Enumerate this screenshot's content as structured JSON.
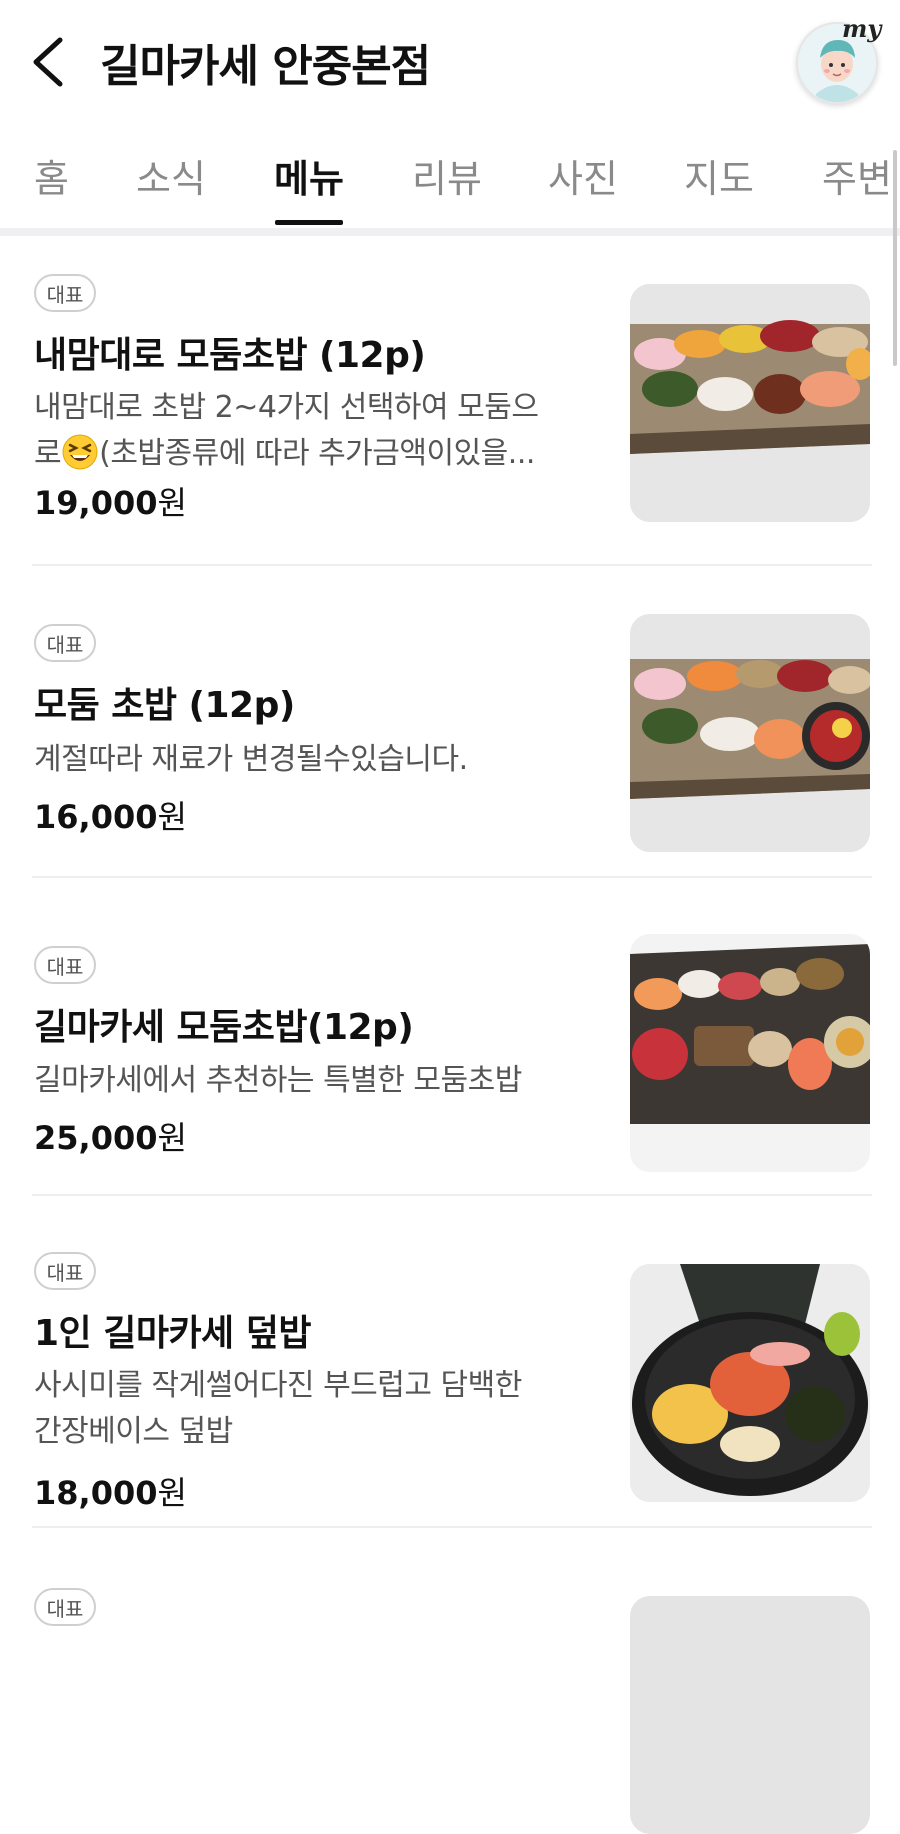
{
  "header": {
    "title": "길마카세 안중본점",
    "back_icon": "chevron-left-icon",
    "avatar_label": "my"
  },
  "tabs": [
    {
      "label": "홈"
    },
    {
      "label": "소식"
    },
    {
      "label": "메뉴",
      "active": true
    },
    {
      "label": "리뷰"
    },
    {
      "label": "사진"
    },
    {
      "label": "지도"
    },
    {
      "label": "주변"
    }
  ],
  "menu": {
    "items": [
      {
        "badge": "대표",
        "name": "내맘대로 모둠초밥 (12p)",
        "desc_line1": "내맘대로 초밥 2~4가지 선택하여 모둠으",
        "desc_line2_a": "로",
        "desc_emoji": "grinning-squinting-face-emoji",
        "desc_line2_b": "(초밥종류에 따라 추가금액이있을...",
        "price": "19,000",
        "unit": "원"
      },
      {
        "badge": "대표",
        "name": "모둠 초밥 (12p)",
        "desc_line1": "계절따라 재료가 변경될수있습니다.",
        "price": "16,000",
        "unit": "원"
      },
      {
        "badge": "대표",
        "name": "길마카세 모둠초밥(12p)",
        "desc_line1": "길마카세에서 추천하는 특별한 모둠초밥",
        "price": "25,000",
        "unit": "원"
      },
      {
        "badge": "대표",
        "name": "1인 길마카세 덮밥",
        "desc_line1": "사시미를 작게썰어다진 부드럽고 담백한",
        "desc_line2": "간장베이스 덮밥",
        "price": "18,000",
        "unit": "원"
      },
      {
        "badge": "대표"
      }
    ]
  },
  "colors": {
    "text_primary": "#111111",
    "text_secondary": "#555555",
    "tab_inactive": "#8a8a8a",
    "divider": "#eeeeee"
  }
}
